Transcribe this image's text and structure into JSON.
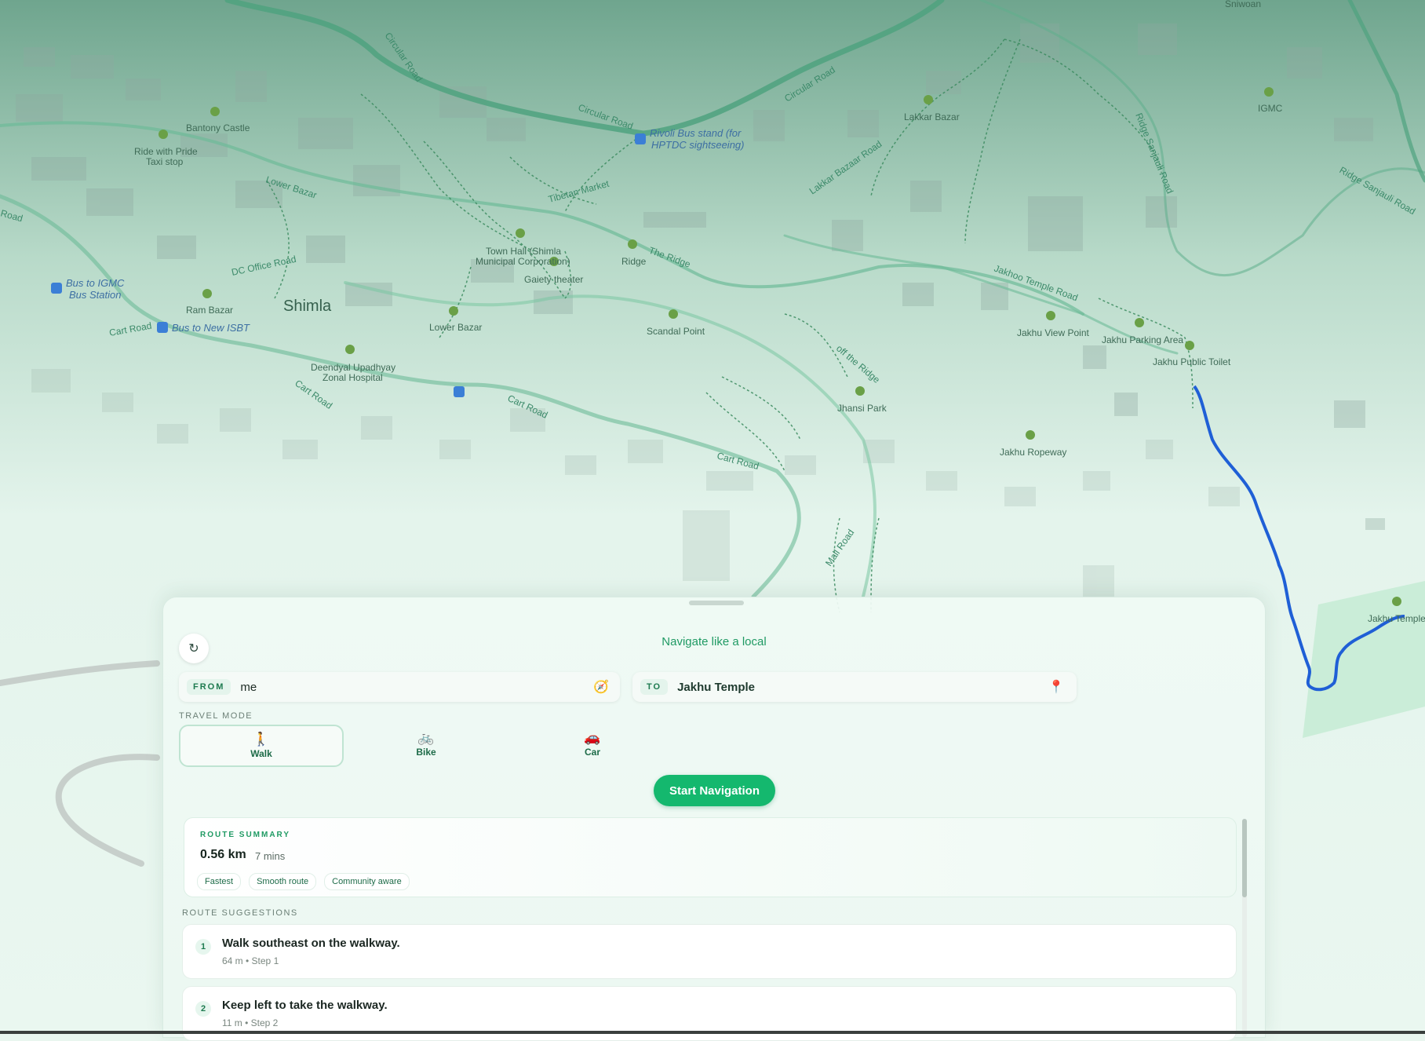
{
  "map": {
    "city": "Shimla",
    "places": [
      {
        "name": "Bantony Castle"
      },
      {
        "name": "Ride with Pride Taxi stop"
      },
      {
        "name": "Ram Bazar"
      },
      {
        "name": "Deendyal Upadhyay Zonal Hospital"
      },
      {
        "name": "Lower Bazar"
      },
      {
        "name": "Town Hall (Shimla Municipal Corporation)"
      },
      {
        "name": "Gaiety theater"
      },
      {
        "name": "Ridge"
      },
      {
        "name": "Scandal Point"
      },
      {
        "name": "Lakkar Bazar"
      },
      {
        "name": "IGMC"
      },
      {
        "name": "Jakhu View Point"
      },
      {
        "name": "Jakhu Parking Area"
      },
      {
        "name": "Jakhu Public Toilet"
      },
      {
        "name": "Jhansi Park"
      },
      {
        "name": "Jakhu Ropeway"
      },
      {
        "name": "Jakhu Temple"
      },
      {
        "name": "Sniwoan"
      }
    ],
    "roads": [
      "Circular Road",
      "Circular Road",
      "Circular Road",
      "Lower Bazar",
      "Tibetan Market",
      "DC Office Road",
      "Cart Road",
      "Cart Road",
      "Cart Road",
      "Cart Road",
      "Road",
      "The Ridge",
      "Lakkar Bazaar Road",
      "Ridge Sanjauli Road",
      "Ridge Sanjauli Road",
      "Jakhoo Temple Road",
      "off the Ridge",
      "Mall Road"
    ],
    "bus_stops": [
      "Rivoli Bus stand (for HPTDC sightseeing)",
      "Bus to IGMC Bus Station",
      "Bus to New ISBT"
    ],
    "route_color": "#1f5fd6"
  },
  "panel": {
    "title": "Navigate like a local",
    "reset_icon": "refresh-icon",
    "from": {
      "tag": "FROM",
      "value": "me",
      "icon": "compass-icon"
    },
    "to": {
      "tag": "TO",
      "value": "Jakhu Temple",
      "icon": "pin-icon"
    },
    "travel_mode_label": "TRAVEL MODE",
    "modes": [
      {
        "label": "Walk",
        "glyph": "🚶",
        "active": true
      },
      {
        "label": "Bike",
        "glyph": "🚲",
        "active": false
      },
      {
        "label": "Car",
        "glyph": "🚗",
        "active": false
      }
    ],
    "start_button": "Start Navigation",
    "summary": {
      "heading": "ROUTE SUMMARY",
      "distance": "0.56 km",
      "time": "7 mins",
      "tags": [
        "Fastest",
        "Smooth route",
        "Community aware"
      ]
    },
    "suggestions_label": "ROUTE SUGGESTIONS",
    "steps": [
      {
        "num": "1",
        "text": "Walk southeast on the walkway.",
        "meta": "64 m • Step 1"
      },
      {
        "num": "2",
        "text": "Keep left to take the walkway.",
        "meta": "11 m • Step 2"
      }
    ],
    "accent": "#14b86e"
  }
}
